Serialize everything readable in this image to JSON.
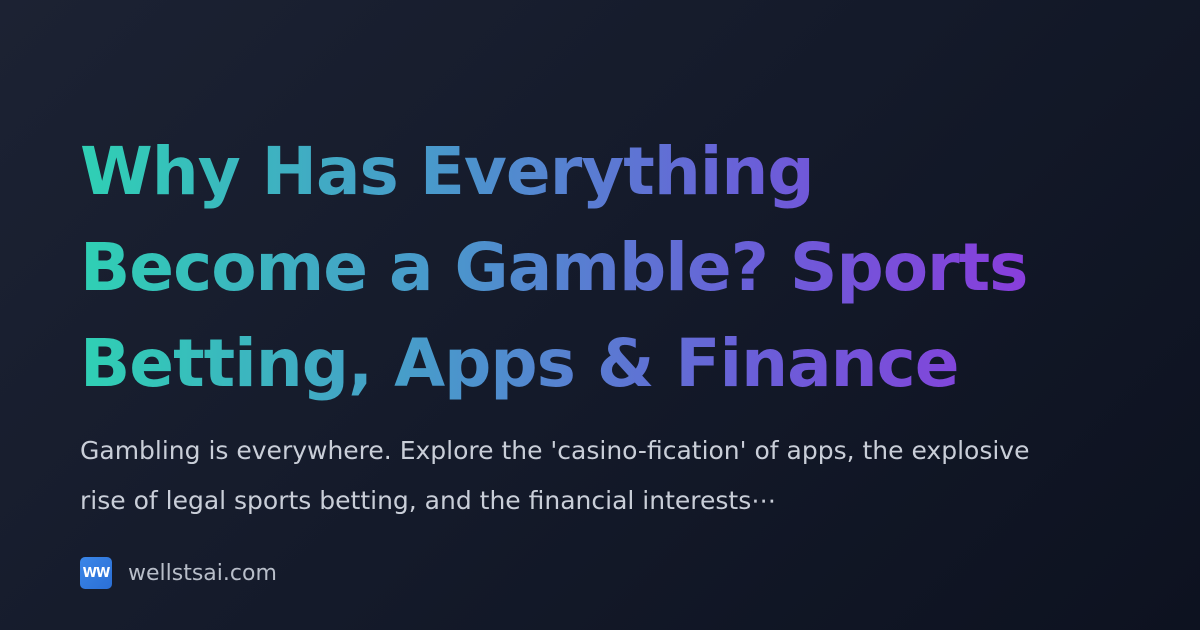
{
  "title": "Why Has Everything Become a Gamble? Sports Betting, Apps & Finance",
  "description": "Gambling is everywhere. Explore the 'casino-fication' of apps, the explosive rise of legal sports betting, and the financial interests⋯",
  "brand": {
    "logo_text": "WW",
    "site": "wellstsai.com",
    "logo_color": "#3a86e8"
  },
  "colors": {
    "title_gradient_start": "#2fd0b4",
    "title_gradient_mid": "#6a5fd8",
    "title_gradient_end": "#8a3cdc",
    "background": "#141a2a",
    "description_text": "#c9ced8"
  }
}
